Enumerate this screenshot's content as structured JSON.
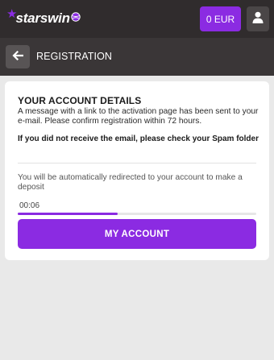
{
  "header": {
    "logo_text": "starswin",
    "balance_label": "0 EUR",
    "icons": {
      "logo_star": "star-icon",
      "logo_ball": "ball-icon",
      "user": "user-icon"
    },
    "colors": {
      "accent": "#8b2be2",
      "topbar": "#302c2d"
    }
  },
  "subheader": {
    "title": "REGISTRATION",
    "back_icon": "arrow-left-icon"
  },
  "card": {
    "title": "YOUR ACCOUNT DETAILS",
    "message": "A message with a link to the activation page has been sent to your e-mail. Please confirm registration within 72 hours.",
    "spam_notice": "If you did not receive the email, please check your Spam folder",
    "redirect_text": "You will be automatically redirected to your account to make a deposit",
    "timer": "00:06",
    "progress": 0.42,
    "button_label": "MY ACCOUNT"
  }
}
